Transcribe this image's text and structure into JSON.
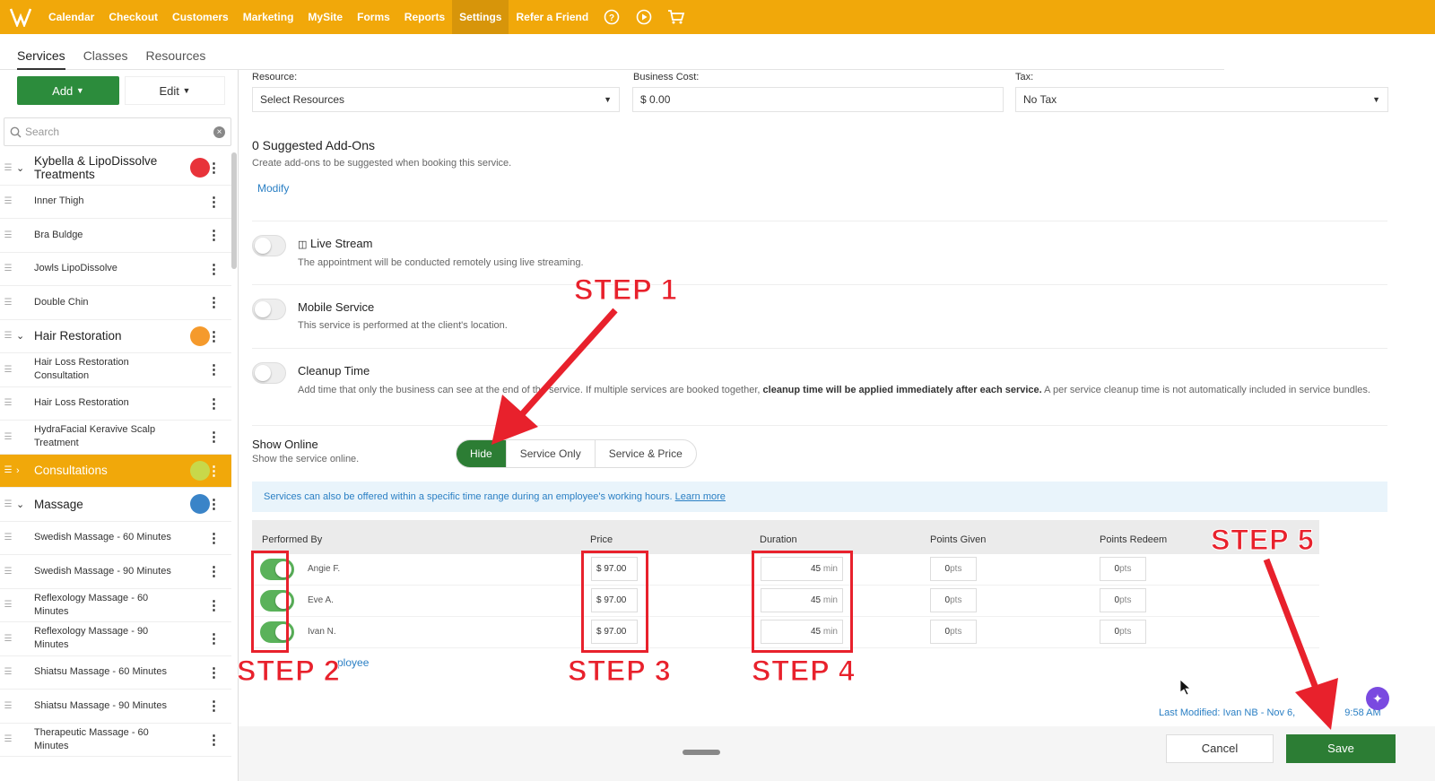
{
  "topnav": {
    "items": [
      "Calendar",
      "Checkout",
      "Customers",
      "Marketing",
      "MySite",
      "Forms",
      "Reports",
      "Settings",
      "Refer a Friend"
    ],
    "active": "Settings",
    "icons": [
      "help-icon",
      "play-icon",
      "cart-icon"
    ],
    "color": "#f1a80a"
  },
  "subtabs": [
    "Services",
    "Classes",
    "Resources"
  ],
  "sidebar": {
    "add_label": "Add",
    "edit_label": "Edit",
    "search_placeholder": "Search",
    "items": [
      {
        "label": "Kybella & LipoDissolve Treatments",
        "type": "category",
        "dot": "#e8333a"
      },
      {
        "label": "Inner Thigh",
        "type": "service"
      },
      {
        "label": "Bra Buldge",
        "type": "service"
      },
      {
        "label": "Jowls LipoDissolve",
        "type": "service"
      },
      {
        "label": "Double Chin",
        "type": "service"
      },
      {
        "label": "Hair Restoration",
        "type": "category",
        "dot": "#f59a2c"
      },
      {
        "label": "Hair Loss Restoration Consultation",
        "type": "service"
      },
      {
        "label": "Hair Loss Restoration",
        "type": "service"
      },
      {
        "label": "HydraFacial Keravive Scalp Treatment",
        "type": "service"
      },
      {
        "label": "Consultations",
        "type": "category",
        "dot": "#c8d84a",
        "selected": true
      },
      {
        "label": "Massage",
        "type": "category",
        "dot": "#3a84c8"
      },
      {
        "label": "Swedish Massage - 60 Minutes",
        "type": "service"
      },
      {
        "label": "Swedish Massage - 90 Minutes",
        "type": "service"
      },
      {
        "label": "Reflexology Massage - 60 Minutes",
        "type": "service"
      },
      {
        "label": "Reflexology Massage - 90 Minutes",
        "type": "service"
      },
      {
        "label": "Shiatsu Massage - 60 Minutes",
        "type": "service"
      },
      {
        "label": "Shiatsu Massage - 90 Minutes",
        "type": "service"
      },
      {
        "label": "Therapeutic Massage - 60 Minutes",
        "type": "service"
      }
    ]
  },
  "fields": {
    "resource_label": "Resource:",
    "resource_value": "Select Resources",
    "cost_label": "Business Cost:",
    "cost_value": "$ 0.00",
    "tax_label": "Tax:",
    "tax_value": "No Tax"
  },
  "addons": {
    "title": "0  Suggested Add-Ons",
    "desc": "Create add-ons to be suggested when booking this service.",
    "link": "Modify"
  },
  "options": [
    {
      "title": "Live Stream",
      "desc": "The appointment will be conducted remotely using live streaming.",
      "on": false
    },
    {
      "title": "Mobile Service",
      "desc": "This service is performed at the client's location.",
      "on": false
    },
    {
      "title": "Cleanup Time",
      "desc_a": "Add time that only the business can see at the end of the service. If multiple services are booked together, ",
      "desc_b": "cleanup time will be applied immediately after each service.",
      "desc_c": " A per service cleanup time is not automatically included in service bundles.",
      "on": false
    }
  ],
  "show_online": {
    "title": "Show Online",
    "desc": "Show the service online.",
    "choices": [
      "Hide",
      "Service Only",
      "Service & Price"
    ],
    "selected": "Hide"
  },
  "info": {
    "text": "Services can also be offered within a specific time range during an employee's working hours.",
    "link": "Learn more"
  },
  "table": {
    "headers": [
      "Performed By",
      "Price",
      "Duration",
      "Points Given",
      "Points Redeem"
    ],
    "rows": [
      {
        "name": "Angie F.",
        "price": "$ 97.00",
        "duration": "45",
        "unit": "min",
        "given": "0",
        "redeem": "0",
        "pts": "pts",
        "on": true
      },
      {
        "name": "Eve A.",
        "price": "$ 97.00",
        "duration": "45",
        "unit": "min",
        "given": "0",
        "redeem": "0",
        "pts": "pts",
        "on": true
      },
      {
        "name": "Ivan N.",
        "price": "$ 97.00",
        "duration": "45",
        "unit": "min",
        "given": "0",
        "redeem": "0",
        "pts": "pts",
        "on": true
      }
    ],
    "add_employee": "ployee"
  },
  "steps": [
    "STEP 1",
    "STEP 2",
    "STEP 3",
    "STEP 4",
    "STEP 5"
  ],
  "footer": {
    "modified": "Last Modified: Ivan NB - Nov 6,",
    "modified_time": "9:58 AM",
    "cancel": "Cancel",
    "save": "Save"
  }
}
